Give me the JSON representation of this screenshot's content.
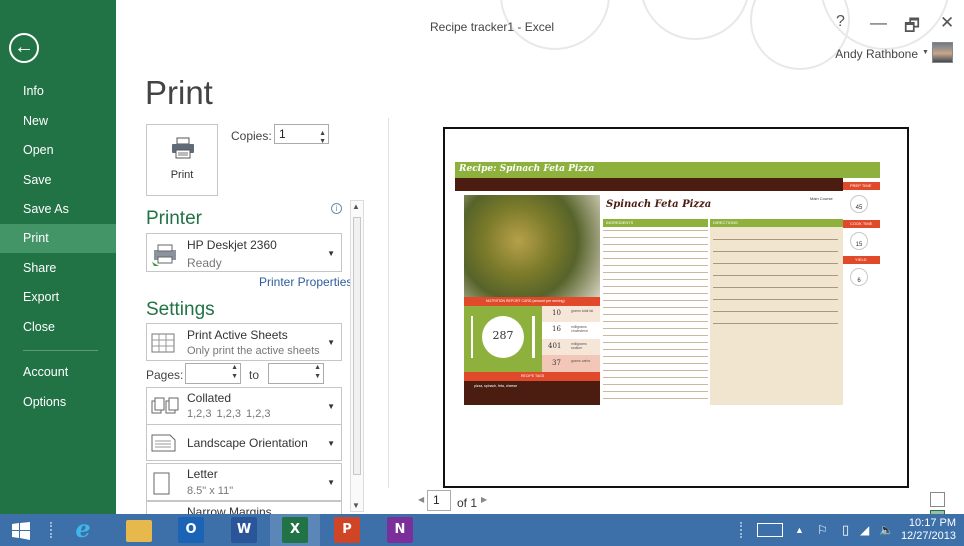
{
  "window": {
    "title": "Recipe tracker1 - Excel",
    "user_name": "Andy Rathbone",
    "help": "?",
    "minimize": "—",
    "restore": "🗗",
    "close": "✕"
  },
  "nav": {
    "back_icon": "←",
    "items": [
      {
        "label": "Info"
      },
      {
        "label": "New"
      },
      {
        "label": "Open"
      },
      {
        "label": "Save"
      },
      {
        "label": "Save As"
      },
      {
        "label": "Print"
      },
      {
        "label": "Share"
      },
      {
        "label": "Export"
      },
      {
        "label": "Close"
      },
      {
        "label": "Account"
      },
      {
        "label": "Options"
      }
    ],
    "active": "Print"
  },
  "print": {
    "heading": "Print",
    "button_label": "Print",
    "copies_label": "Copies:",
    "copies_value": "1",
    "printer_heading": "Printer",
    "printer_name": "HP Deskjet 2360",
    "printer_status": "Ready",
    "printer_properties": "Printer Properties",
    "settings_heading": "Settings",
    "scope_main": "Print Active Sheets",
    "scope_sub": "Only print the active sheets",
    "pages_label": "Pages:",
    "to_label": "to",
    "collate_main": "Collated",
    "collate_sub": "1,2,3   1,2,3   1,2,3",
    "orientation": "Landscape Orientation",
    "paper_main": "Letter",
    "paper_sub": "8.5\" x 11\"",
    "margins_main": "Narrow Margins"
  },
  "preview": {
    "page_current": "1",
    "page_of": "of 1",
    "recipe_banner": "Recipe: Spinach Feta Pizza",
    "recipe_title": "Spinach Feta Pizza",
    "course": "Main Course",
    "ingredients_h": "INGREDIENTS",
    "directions_h": "DIRECTIONS",
    "prep_label": "PREP TIME",
    "prep_value": "45",
    "cook_label": "COOK TIME",
    "cook_value": "15",
    "yield_label": "YIELD",
    "yield_value": "6",
    "nutrition_h": "NUTRITION REPORT CARD (amount per serving)",
    "calories": "287",
    "nutrients": [
      {
        "value": "10",
        "label": "grams total fat"
      },
      {
        "value": "16",
        "label": "milligrams cholesterol"
      },
      {
        "value": "401",
        "label": "milligrams sodium"
      },
      {
        "value": "37",
        "label": "grams carbs"
      }
    ],
    "tags_h": "RECIPE TAGS",
    "tags_text": "pizza, spinach, feta, cheese"
  },
  "taskbar": {
    "time": "10:17 PM",
    "date": "12/27/2013",
    "apps": [
      {
        "name": "ie",
        "label": "e",
        "color": "#2a9fd6"
      },
      {
        "name": "explorer",
        "label": "",
        "color": "#e7b84c"
      },
      {
        "name": "outlook",
        "label": "O",
        "color": "#1b64b5"
      },
      {
        "name": "word",
        "label": "W",
        "color": "#2a5699"
      },
      {
        "name": "excel",
        "label": "X",
        "color": "#217346"
      },
      {
        "name": "powerpoint",
        "label": "P",
        "color": "#d04525"
      },
      {
        "name": "onenote",
        "label": "N",
        "color": "#7b2f9b"
      }
    ]
  }
}
